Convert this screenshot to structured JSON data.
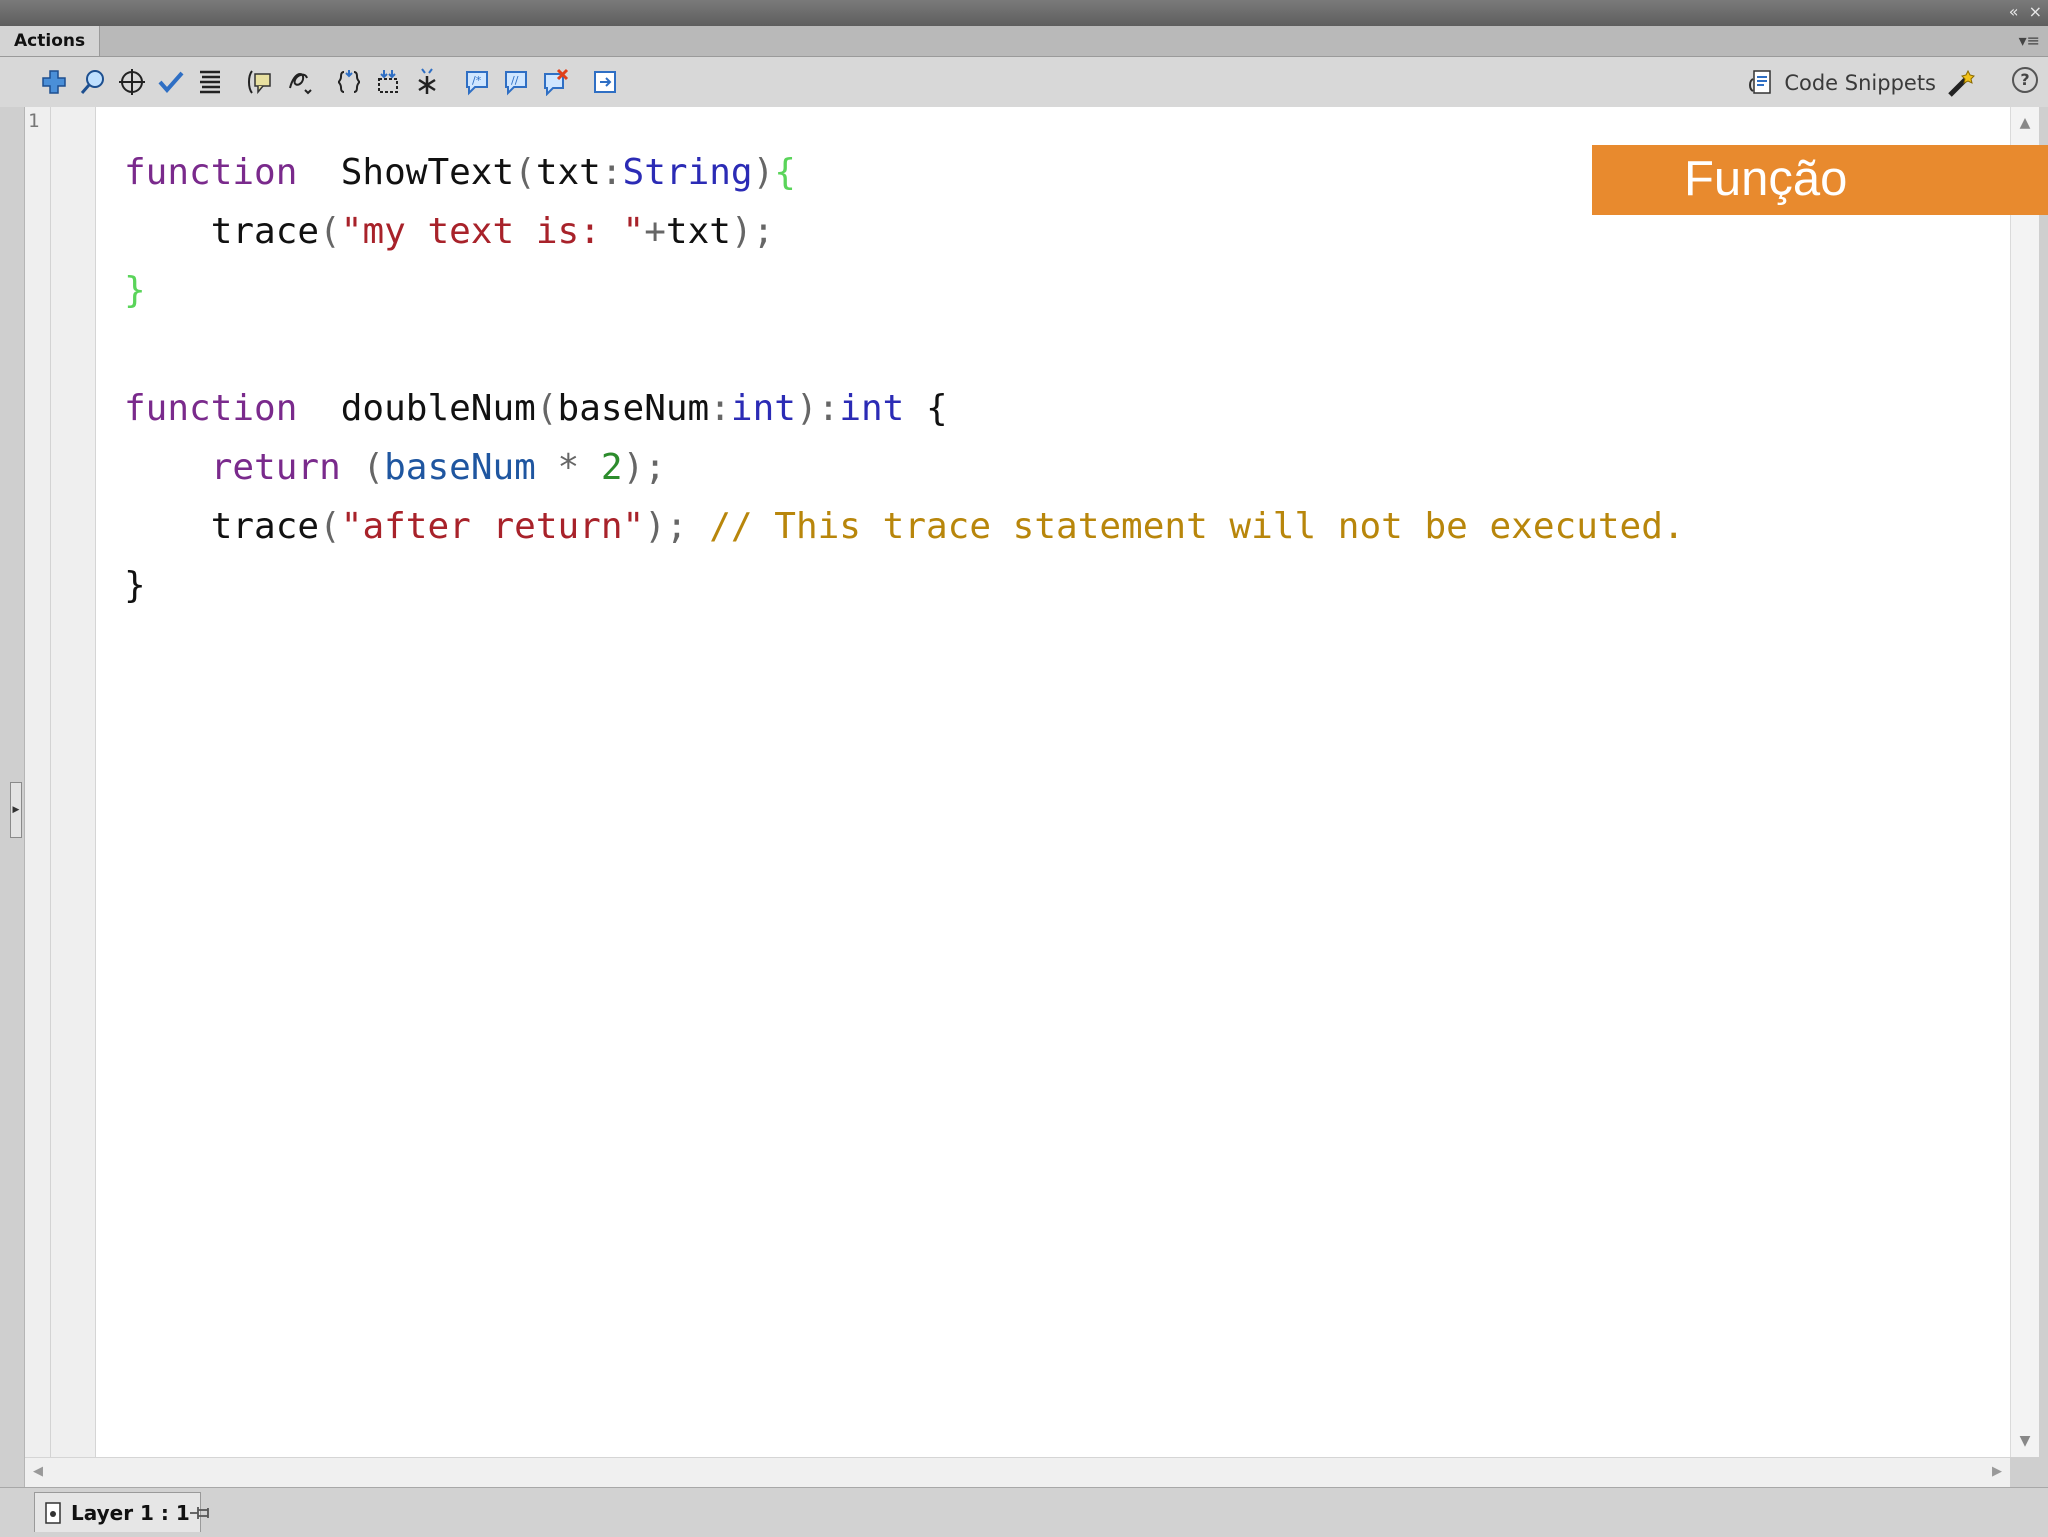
{
  "panel": {
    "tab_label": "Actions",
    "window_controls": [
      "«",
      "×"
    ],
    "menu_glyph": "▾≡"
  },
  "toolbar": {
    "icons": [
      "add-script-item-icon",
      "find-icon",
      "target-path-icon",
      "check-syntax-icon",
      "auto-format-icon",
      "code-hint-icon",
      "debug-options-icon",
      "collapse-between-braces-icon",
      "collapse-selection-icon",
      "expand-all-icon",
      "apply-block-comment-icon",
      "apply-line-comment-icon",
      "remove-comment-icon",
      "show-hide-toolbox-icon"
    ],
    "code_snippets_label": "Code Snippets",
    "help_glyph": "?"
  },
  "editor": {
    "line_number": "1",
    "colors": {
      "keyword": "#7a2a8c",
      "type": "#2b2bb5",
      "string": "#a8222a",
      "number": "#2c8c2c",
      "brace_highlight": "#5ad45a",
      "comment": "#b8860b"
    },
    "code": {
      "f1_kw": "function",
      "f1_name": "ShowText",
      "f1_param": "txt",
      "f1_type": "String",
      "f1_body_fn": "trace",
      "f1_body_str": "\"my text is: \"",
      "f1_body_var": "txt",
      "f2_kw": "function",
      "f2_name": "doubleNum",
      "f2_param": "baseNum",
      "f2_param_type": "int",
      "f2_ret_type": "int",
      "f2_return_kw": "return",
      "f2_return_var": "baseNum",
      "f2_return_num": "2",
      "f2_trace_fn": "trace",
      "f2_trace_str": "\"after return\"",
      "f2_comment": "// This trace statement will not be executed."
    }
  },
  "status": {
    "layer_label": "Layer 1 : 1"
  },
  "banner": {
    "text": "Função",
    "color": "#e88a2e"
  }
}
